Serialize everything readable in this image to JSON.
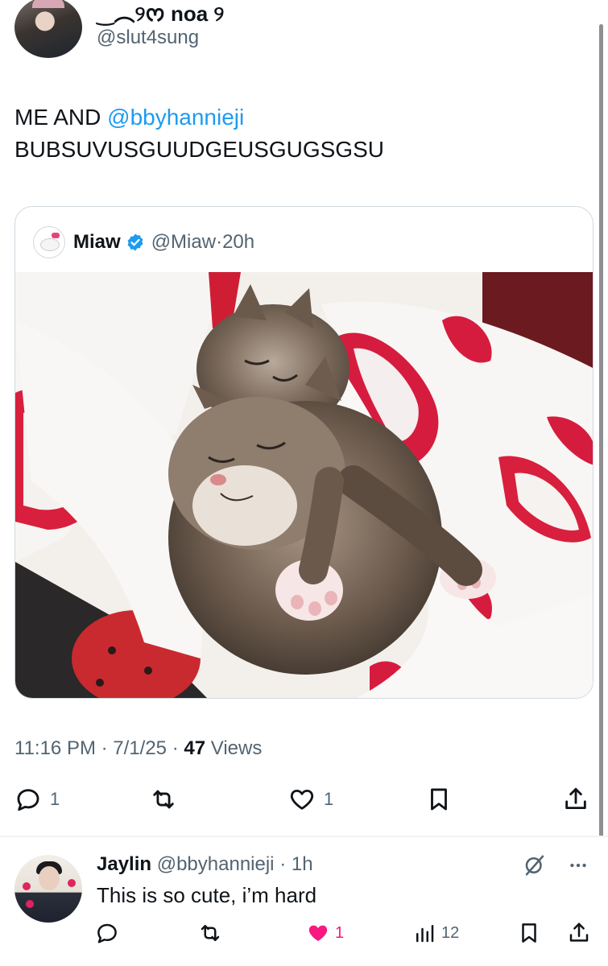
{
  "tweet": {
    "author": {
      "display_name": "‿︵୨ᰔ noa ୨",
      "handle": "@slut4sung"
    },
    "text_prefix": "ME AND",
    "mention": "@bbyhannieji",
    "text_line2": "BUBSUVUSGUUDGEUSGUGSGSU",
    "quote": {
      "name": "Miaw",
      "handle": "@Miaw",
      "time": "20h",
      "image": "photo of two tabby kittens sleeping under a white blanket with red hearts"
    },
    "time": "11:16 PM",
    "date": "7/1/25",
    "views_count": "47",
    "views_label": "Views",
    "actions": {
      "reply_count": "1",
      "like_count": "1"
    }
  },
  "reply": {
    "name": "Jaylin",
    "handle": "@bbyhannieji",
    "time": "1h",
    "text": "This is so cute, i’m hard",
    "actions": {
      "like_count": "1",
      "views_count": "12"
    }
  },
  "colors": {
    "accent": "#1d9bf0",
    "secondary_text": "#536471",
    "like_pink": "#f91880"
  }
}
